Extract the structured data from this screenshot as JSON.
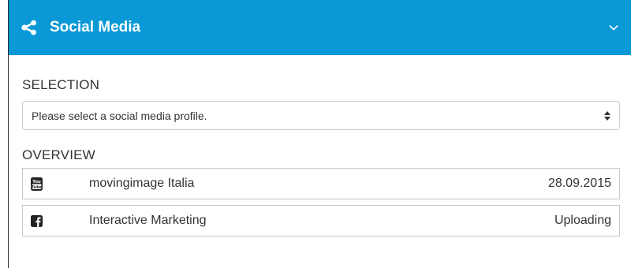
{
  "header": {
    "title": "Social Media",
    "icon": "share-icon",
    "toggle_icon": "chevron-down-icon",
    "color": "#0a99d6"
  },
  "selection": {
    "label": "SELECTION",
    "placeholder": "Please select a social media profile.",
    "icon": "select-arrows-icon"
  },
  "overview": {
    "label": "OVERVIEW",
    "rows": [
      {
        "icon": "youtube-icon",
        "icon_text": "You\nTube",
        "name": "movingimage Italia",
        "value": "28.09.2015"
      },
      {
        "icon": "facebook-icon",
        "icon_text": "f",
        "name": "Interactive Marketing",
        "value": "Uploading"
      }
    ]
  }
}
